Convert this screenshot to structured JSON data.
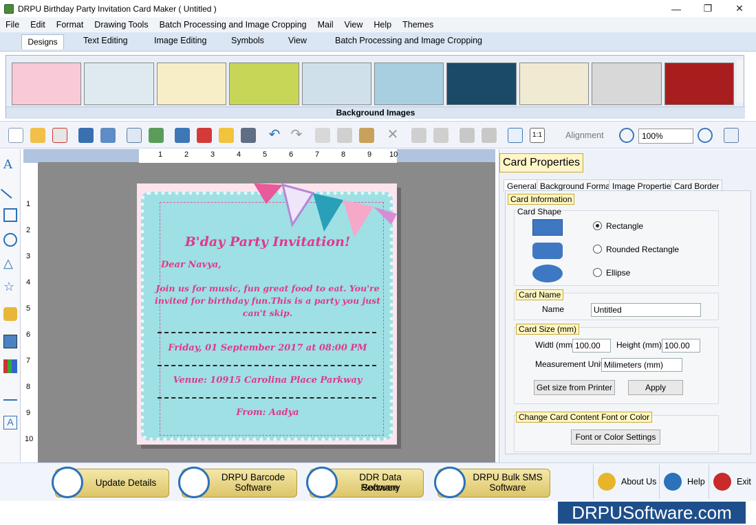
{
  "window": {
    "title": "DRPU Birthday Party Invitation Card Maker ( Untitled )",
    "minimize": "—",
    "maximize": "❐",
    "close": "✕"
  },
  "menu": [
    "File",
    "Edit",
    "Format",
    "Drawing Tools",
    "Batch Processing and Image Cropping",
    "Mail",
    "View",
    "Help",
    "Themes"
  ],
  "ribbon_tabs": [
    "Designs",
    "Text Editing",
    "Image Editing",
    "Symbols",
    "View",
    "Batch Processing and Image Cropping"
  ],
  "gallery": {
    "label": "Background Images",
    "thumbs": [
      "#f9c9d8",
      "#dfeaf0",
      "#f7eec8",
      "#c8d658",
      "#cfe0ea",
      "#a8cfe0",
      "#1a4a66",
      "#f1ead2",
      "#d8d8d8",
      "#a81e1e"
    ]
  },
  "toolbar": {
    "alignment": "Alignment",
    "zoom": "100%"
  },
  "ruler": {
    "h": [
      "1",
      "2",
      "3",
      "4",
      "5",
      "6",
      "7",
      "8",
      "9",
      "10"
    ],
    "v": [
      "1",
      "2",
      "3",
      "4",
      "5",
      "6",
      "7",
      "8",
      "9",
      "10"
    ]
  },
  "card": {
    "title": "B'day Party Invitation!",
    "greeting": "Dear Navya,",
    "body_1": "Join us for music, fun great food to eat. You're",
    "body_2": "invited for birthday fun.This is a party you just",
    "body_3": "can't skip.",
    "date": "Friday, 01 September 2017 at 08:00 PM",
    "venue": "Venue: 10915 Carolina Place Parkway",
    "from": "From: Aadya"
  },
  "properties": {
    "title": "Card Properties",
    "tabs": [
      "General",
      "Background Format",
      "Image Properties",
      "Card Border"
    ],
    "card_information": "Card Information",
    "card_shape": "Card Shape",
    "shapes": [
      "Rectangle",
      "Rounded Rectangle",
      "Ellipse"
    ],
    "card_name_label": "Card Name",
    "name_label": "Name",
    "name_value": "Untitled",
    "card_size_label": "Card Size (mm)",
    "width_label": "Widtl (mm)",
    "width_value": "100.00",
    "height_label": "Height",
    "height_unit": "(mm)",
    "height_value": "100.00",
    "measurement_label": "Measurement Unit :",
    "measurement_value": "Milimeters (mm)",
    "get_size_button": "Get size from Printer",
    "apply_button": "Apply",
    "change_font_label": "Change Card Content Font or Color",
    "font_color_button": "Font or Color Settings"
  },
  "bottom": {
    "update": "Update Details",
    "barcode_1": "DRPU Barcode",
    "barcode_2": "Software",
    "recovery_1": "DDR Data Recovery",
    "recovery_2": "Software",
    "sms_1": "DRPU Bulk SMS",
    "sms_2": "Software",
    "about": "About Us",
    "help": "Help",
    "exit": "Exit"
  },
  "brand": "DRPUSoftware.com"
}
